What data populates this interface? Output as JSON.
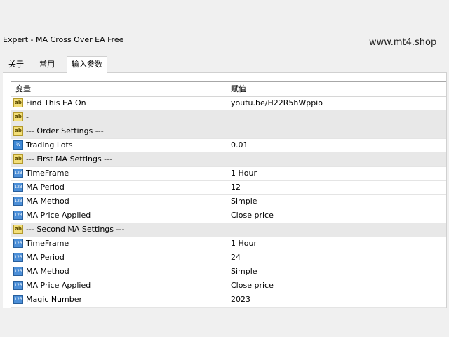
{
  "window": {
    "title": "Expert - MA Cross Over EA Free"
  },
  "watermark": "www.mt4.shop",
  "tabs": [
    {
      "label": "关于"
    },
    {
      "label": "常用"
    },
    {
      "label": "输入参数"
    }
  ],
  "grid": {
    "headers": {
      "name": "变量",
      "value": "赋值"
    },
    "rows": [
      {
        "icon": "ab-string-icon",
        "name": "Find This EA On",
        "value": "youtu.be/H22R5hWppio"
      },
      {
        "icon": "ab-string-icon",
        "name": "-",
        "value": ""
      },
      {
        "icon": "ab-string-icon",
        "name": "--- Order Settings ---",
        "value": ""
      },
      {
        "icon": "half-double-icon",
        "name": "Trading Lots",
        "value": "0.01"
      },
      {
        "icon": "ab-string-icon",
        "name": "--- First MA Settings ---",
        "value": ""
      },
      {
        "icon": "123-integer-icon",
        "name": "TimeFrame",
        "value": "1 Hour"
      },
      {
        "icon": "123-integer-icon",
        "name": "MA Period",
        "value": "12"
      },
      {
        "icon": "123-integer-icon",
        "name": "MA Method",
        "value": "Simple"
      },
      {
        "icon": "123-integer-icon",
        "name": "MA Price Applied",
        "value": "Close price"
      },
      {
        "icon": "ab-string-icon",
        "name": "--- Second MA Settings ---",
        "value": ""
      },
      {
        "icon": "123-integer-icon",
        "name": "TimeFrame",
        "value": "1 Hour"
      },
      {
        "icon": "123-integer-icon",
        "name": "MA Period",
        "value": "24"
      },
      {
        "icon": "123-integer-icon",
        "name": "MA Method",
        "value": "Simple"
      },
      {
        "icon": "123-integer-icon",
        "name": "MA Price Applied",
        "value": "Close price"
      },
      {
        "icon": "123-integer-icon",
        "name": "Magic Number",
        "value": "2023"
      }
    ]
  }
}
